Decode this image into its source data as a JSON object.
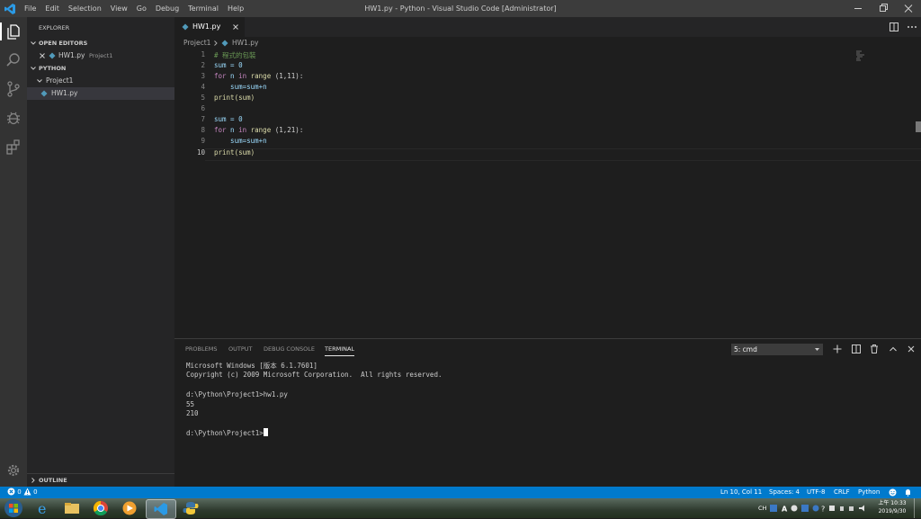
{
  "window": {
    "title": "HW1.py - Python - Visual Studio Code [Administrator]",
    "menu": [
      "File",
      "Edit",
      "Selection",
      "View",
      "Go",
      "Debug",
      "Terminal",
      "Help"
    ]
  },
  "sidebar": {
    "explorer_title": "EXPLORER",
    "open_editors_label": "OPEN EDITORS",
    "open_editor_file": "HW1.py",
    "open_editor_folder": "Project1",
    "workspace_label": "PYTHON",
    "folder": "Project1",
    "file": "HW1.py",
    "outline_label": "OUTLINE"
  },
  "editor": {
    "tab_label": "HW1.py",
    "breadcrumb": [
      "Project1",
      "HW1.py"
    ],
    "line_numbers": [
      "1",
      "2",
      "3",
      "4",
      "5",
      "6",
      "7",
      "8",
      "9",
      "10"
    ],
    "code": {
      "l1": "# 程式的包裝",
      "l2": "sum = 0",
      "l3_kw1": "for",
      "l3_mid": " n ",
      "l3_kw2": "in",
      "l3_fn": " range",
      "l3_rest": " (1,11):",
      "l4": "    sum=sum+n",
      "l5": "print(sum)",
      "l7": "sum = 0",
      "l8_kw1": "for",
      "l8_mid": " n ",
      "l8_kw2": "in",
      "l8_fn": " range",
      "l8_rest": " (1,21):",
      "l9": "    sum=sum+n",
      "l10": "print(sum)"
    }
  },
  "panel": {
    "tabs": [
      "PROBLEMS",
      "OUTPUT",
      "DEBUG CONSOLE",
      "TERMINAL"
    ],
    "terminal_select": "5: cmd",
    "terminal_lines": [
      "Microsoft Windows [版本 6.1.7601]",
      "Copyright (c) 2009 Microsoft Corporation.  All rights reserved.",
      "",
      "d:\\Python\\Project1>hw1.py",
      "55",
      "210",
      "",
      "d:\\Python\\Project1>"
    ]
  },
  "statusbar": {
    "errors": "0",
    "warnings": "0",
    "position": "Ln 10, Col 11",
    "spaces": "Spaces: 4",
    "encoding": "UTF-8",
    "eol": "CRLF",
    "language": "Python"
  },
  "taskbar": {
    "ime": "CH",
    "time": "上午 10:33",
    "date": "2019/9/30"
  },
  "colors": {
    "accent": "#007acc",
    "keyword": "#c586c0",
    "function": "#dcdcaa",
    "comment": "#6a9955",
    "number": "#b5cea8",
    "variable": "#9cdcfe"
  }
}
